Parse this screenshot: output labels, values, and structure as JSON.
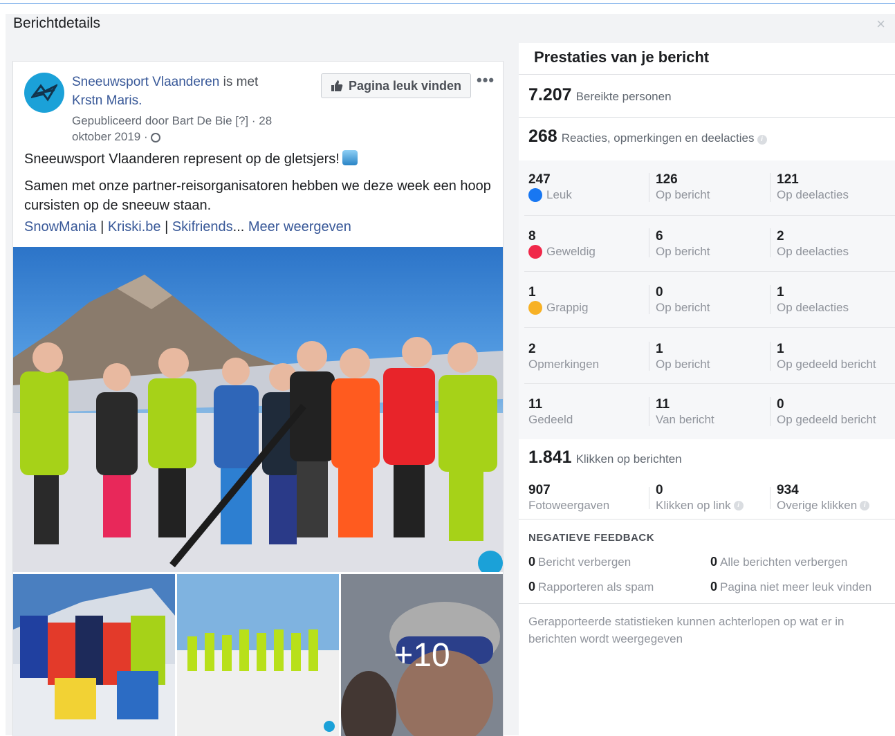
{
  "header": {
    "title": "Berichtdetails",
    "close": "×"
  },
  "post": {
    "page_name": "Sneeuwsport Vlaanderen",
    "with_text": " is met",
    "tagged": "Krstn Maris.",
    "meta_line1": "Gepubliceerd door Bart De Bie [?] · 28",
    "meta_line2": "oktober 2019 · ",
    "like_button": "Pagina leuk vinden",
    "more": "•••",
    "text1": "Sneeuwsport Vlaanderen represent op de gletsjers!",
    "text2": "Samen met onze partner-reisorganisatoren hebben we deze week een hoop cursisten op de sneeuw staan.",
    "link1": "SnowMania",
    "sep1": " | ",
    "link2": "Kriski.be",
    "sep2": " | ",
    "link3": "Skifriends",
    "ellipsis": "... ",
    "more_link": "Meer weergeven",
    "plus_more": "+10"
  },
  "stats": {
    "title": "Prestaties van je bericht",
    "reach": {
      "num": "7.207",
      "label": "Bereikte personen"
    },
    "engagement": {
      "num": "268",
      "label": "Reacties, opmerkingen en deelacties"
    },
    "rows": [
      {
        "a_num": "247",
        "a_label": "Leuk",
        "b_num": "126",
        "b_label": "Op bericht",
        "c_num": "121",
        "c_label": "Op deelacties"
      },
      {
        "a_num": "8",
        "a_label": "Geweldig",
        "b_num": "6",
        "b_label": "Op bericht",
        "c_num": "2",
        "c_label": "Op deelacties"
      },
      {
        "a_num": "1",
        "a_label": "Grappig",
        "b_num": "0",
        "b_label": "Op bericht",
        "c_num": "1",
        "c_label": "Op deelacties"
      },
      {
        "a_num": "2",
        "a_label": "Opmerkingen",
        "b_num": "1",
        "b_label": "Op bericht",
        "c_num": "1",
        "c_label": "Op gedeeld bericht"
      },
      {
        "a_num": "11",
        "a_label": "Gedeeld",
        "b_num": "11",
        "b_label": "Van bericht",
        "c_num": "0",
        "c_label": "Op gedeeld bericht"
      }
    ],
    "clicks": {
      "num": "1.841",
      "label": "Klikken op berichten"
    },
    "click_rows": {
      "a_num": "907",
      "a_label": "Fotoweergaven",
      "b_num": "0",
      "b_label": "Klikken op link",
      "c_num": "934",
      "c_label": "Overige klikken"
    },
    "negative": {
      "title": "NEGATIEVE FEEDBACK",
      "items": [
        {
          "num": "0",
          "label": "Bericht verbergen"
        },
        {
          "num": "0",
          "label": "Alle berichten verbergen"
        },
        {
          "num": "0",
          "label": "Rapporteren als spam"
        },
        {
          "num": "0",
          "label": "Pagina niet meer leuk vinden"
        }
      ]
    },
    "footnote": "Gerapporteerde statistieken kunnen achterlopen op wat er in berichten wordt weergegeven"
  }
}
